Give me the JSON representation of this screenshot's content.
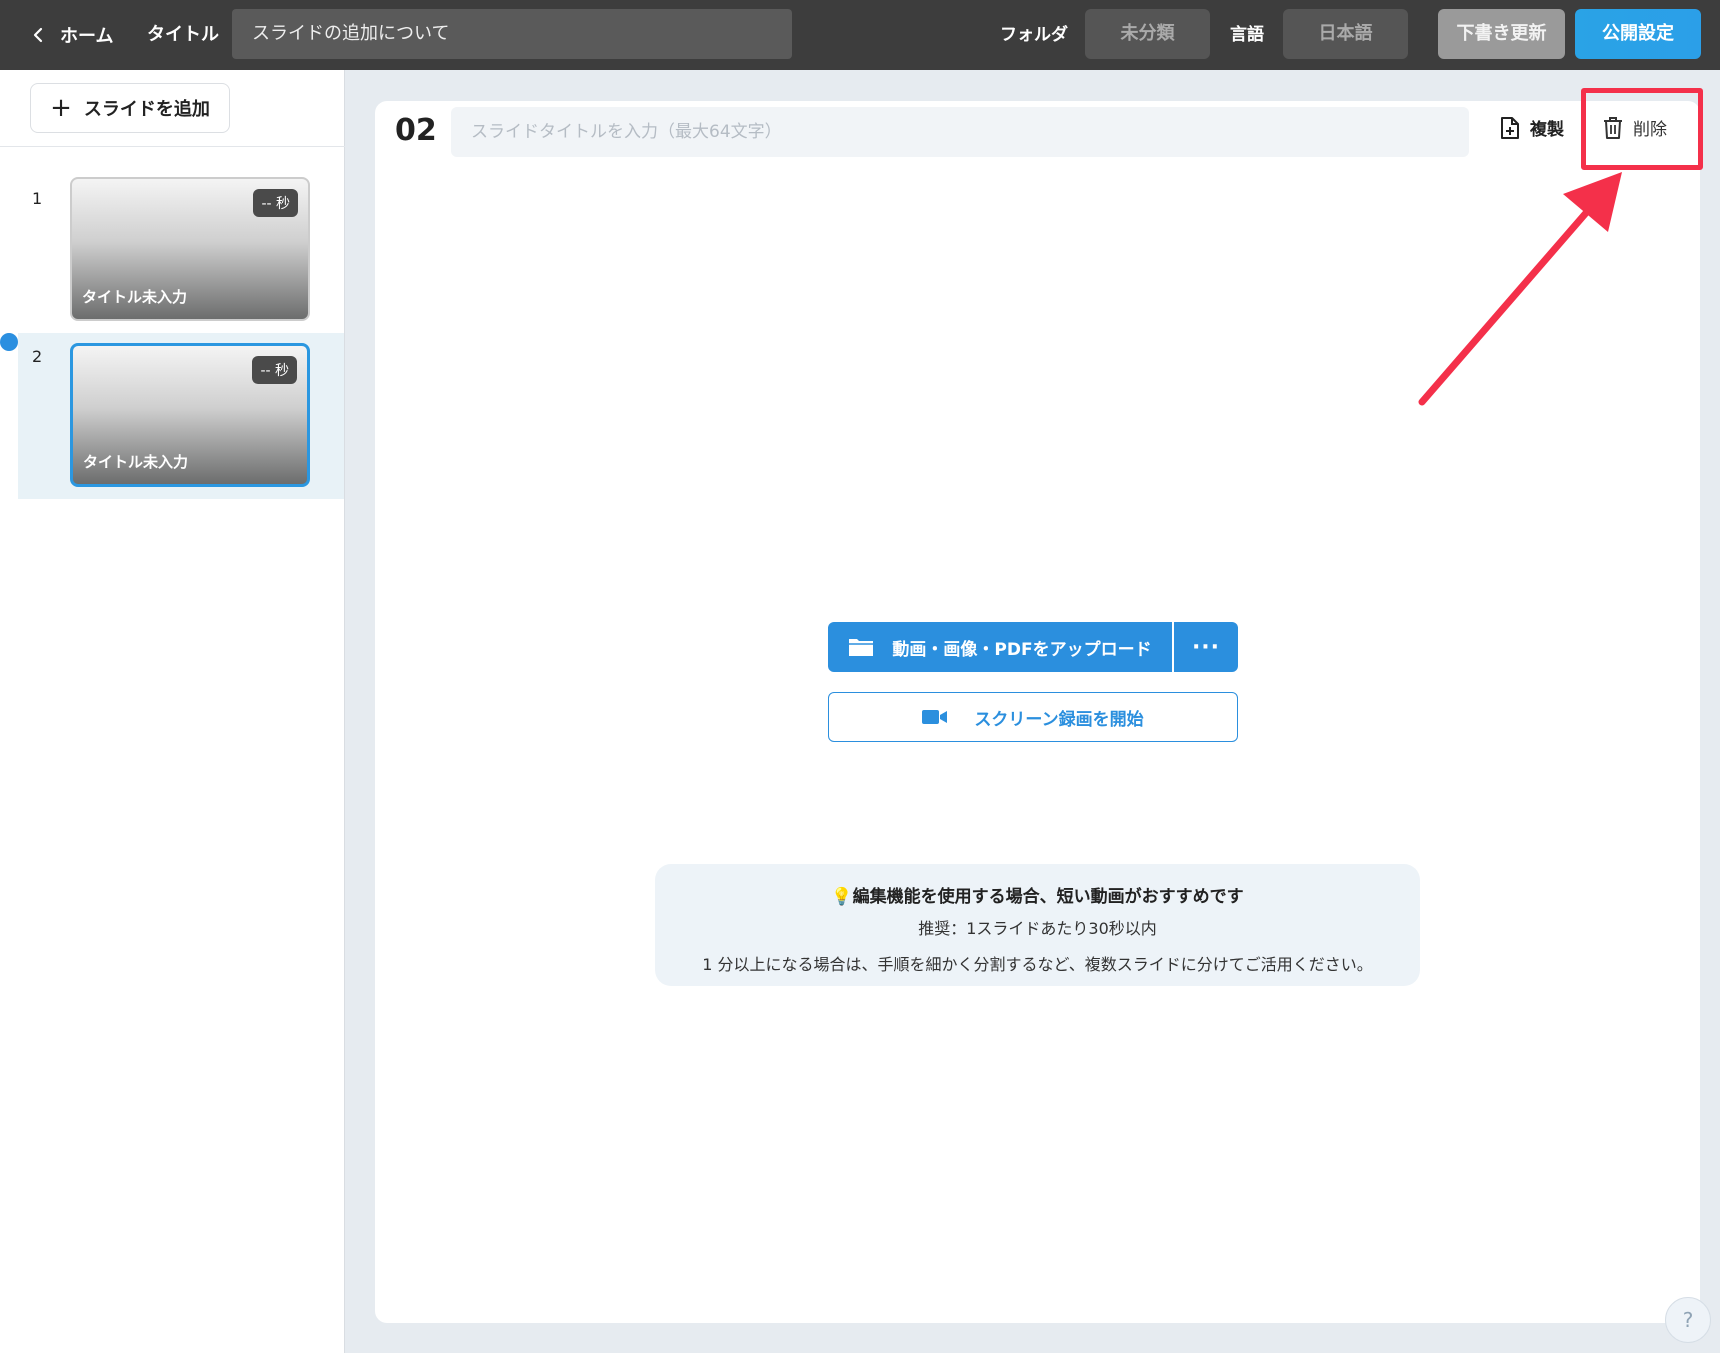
{
  "header": {
    "back_label": "ホーム",
    "title_label": "タイトル",
    "title_value": "スライドの追加について",
    "folder_label": "フォルダ",
    "folder_value": "未分類",
    "language_label": "言語",
    "language_value": "日本語",
    "draft_button": "下書き更新",
    "publish_button": "公開設定"
  },
  "sidebar": {
    "add_slide_label": "スライドを追加",
    "slides": [
      {
        "number": "1",
        "duration": "-- 秒",
        "title": "タイトル未入力"
      },
      {
        "number": "2",
        "duration": "-- 秒",
        "title": "タイトル未入力"
      }
    ],
    "active_slide": 2
  },
  "editor": {
    "slide_index": "02",
    "title_placeholder": "スライドタイトルを入力（最大64文字）",
    "duplicate_label": "複製",
    "delete_label": "削除",
    "upload_label": "動画・画像・PDFをアップロード",
    "more_label": "···",
    "record_label": "スクリーン録画を開始",
    "tip": {
      "headline": "編集機能を使用する場合、短い動画がおすすめです",
      "recommend": "推奨：1スライドあたり30秒以内",
      "detail": "1 分以上になる場合は、手順を細かく分割するなど、複数スライドに分けてご活用ください。"
    }
  },
  "help_label": "?",
  "colors": {
    "topbar": "#3d3d3d",
    "accent_blue": "#2b8fde",
    "highlight_red": "#f4304a"
  }
}
